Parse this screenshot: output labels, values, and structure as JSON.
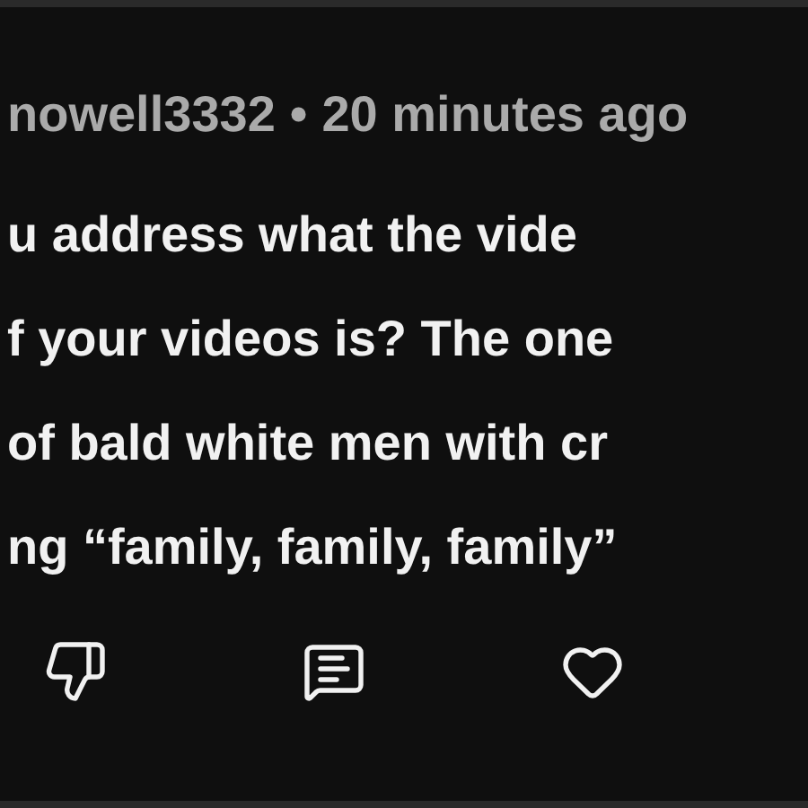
{
  "comment": {
    "author": "nowell3332",
    "separator": "•",
    "time": "20 minutes ago",
    "lines": [
      "u address what the vide",
      "f your videos is? The one",
      "of bald white men with cr",
      "ng “family, family, family”"
    ]
  },
  "actions": [
    {
      "kind": "dislike"
    },
    {
      "kind": "reply"
    },
    {
      "kind": "like"
    }
  ]
}
